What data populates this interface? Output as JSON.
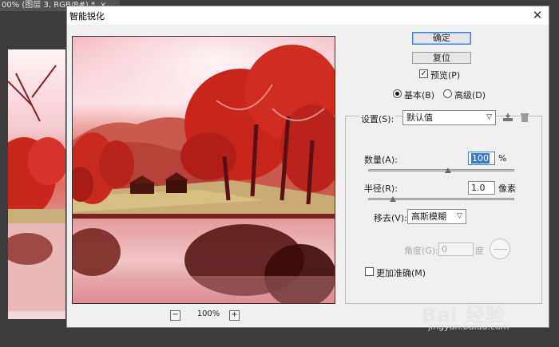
{
  "background": {
    "doc_tab": "00% (图层 3, RGB/8#) *",
    "doc_tab_close": "×"
  },
  "dialog": {
    "title": "智能锐化",
    "close": "✕"
  },
  "zoom": {
    "minus": "−",
    "value": "100%",
    "plus": "+"
  },
  "buttons": {
    "ok": "确定",
    "reset": "复位"
  },
  "preview": {
    "label": "预览(P)",
    "checked": true
  },
  "mode": {
    "basic": "基本(B)",
    "advanced": "高级(D)",
    "selected": "basic"
  },
  "settings": {
    "label": "设置(S):",
    "value": "默认值",
    "save_icon": "save-preset-icon",
    "delete_icon": "delete-preset-icon"
  },
  "amount": {
    "label": "数量(A):",
    "value": "100",
    "unit": "%",
    "slider_fraction": 0.5
  },
  "radius": {
    "label": "半径(R):",
    "value": "1.0",
    "unit": "像素",
    "slider_fraction": 0.16
  },
  "remove": {
    "label": "移去(V):",
    "value": "高斯模糊"
  },
  "angle": {
    "label": "角度(G):",
    "value": "0",
    "unit": "度"
  },
  "more_accurate": {
    "label": "更加准确(M)",
    "checked": false
  },
  "watermark": {
    "main": "Bai 经验",
    "sub": "jingyan.baidu.com"
  }
}
